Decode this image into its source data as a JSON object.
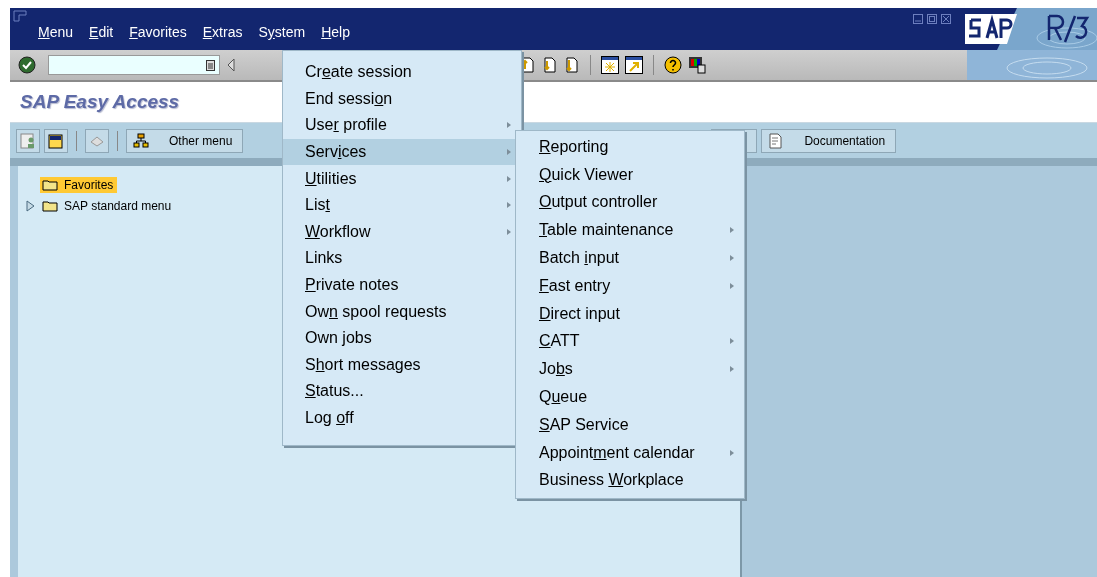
{
  "menu_bar": [
    {
      "label": {
        "key": "M",
        "after": "enu"
      }
    },
    {
      "label": {
        "key": "E",
        "after": "dit"
      }
    },
    {
      "label": {
        "key": "F",
        "after": "avorites"
      }
    },
    {
      "label": {
        "key": "E",
        "after": "xtras"
      }
    },
    {
      "label": {
        "before": "S",
        "key": "y",
        "after": "stem"
      }
    },
    {
      "label": {
        "key": "H",
        "after": "elp"
      }
    }
  ],
  "screen_title": "SAP Easy Access",
  "app_toolbar": {
    "buttons": [
      {
        "label": "Other menu"
      },
      {
        "label": "Documentation"
      }
    ]
  },
  "tree": [
    {
      "label": "Favorites",
      "selected": true,
      "expandable": false
    },
    {
      "label": "SAP standard menu",
      "selected": false,
      "expandable": true
    }
  ],
  "system_menu": [
    {
      "label": {
        "before": "Cr",
        "key": "e",
        "after": "ate session"
      },
      "has_submenu": false,
      "selected": false
    },
    {
      "label": {
        "before": "End sessi",
        "key": "o",
        "after": "n"
      },
      "has_submenu": false,
      "selected": false
    },
    {
      "label": {
        "before": "Use",
        "key": "r",
        "after": " profile"
      },
      "has_submenu": true,
      "selected": false
    },
    {
      "label": {
        "before": "Serv",
        "key": "i",
        "after": "ces"
      },
      "has_submenu": true,
      "selected": true
    },
    {
      "label": {
        "key": "U",
        "after": "tilities"
      },
      "has_submenu": true,
      "selected": false
    },
    {
      "label": {
        "before": "Lis",
        "key": "t"
      },
      "has_submenu": true,
      "selected": false
    },
    {
      "label": {
        "key": "W",
        "after": "orkflow"
      },
      "has_submenu": true,
      "selected": false
    },
    {
      "label": {
        "before": "Links"
      },
      "has_submenu": false,
      "selected": false
    },
    {
      "label": {
        "key": "P",
        "after": "rivate notes"
      },
      "has_submenu": false,
      "selected": false
    },
    {
      "label": {
        "before": "Ow",
        "key": "n",
        "after": " spool requests"
      },
      "has_submenu": false,
      "selected": false
    },
    {
      "label": {
        "before": "Own ",
        "key": "j",
        "after": "obs"
      },
      "has_submenu": false,
      "selected": false
    },
    {
      "label": {
        "before": "S",
        "key": "h",
        "after": "ort messages"
      },
      "has_submenu": false,
      "selected": false
    },
    {
      "label": {
        "key": "S",
        "after": "tatus..."
      },
      "has_submenu": false,
      "selected": false
    },
    {
      "label": {
        "before": "Log ",
        "key": "o",
        "after": "ff"
      },
      "has_submenu": false,
      "selected": false
    }
  ],
  "services_submenu": [
    {
      "label": {
        "key": "R",
        "after": "eporting"
      },
      "has_submenu": false
    },
    {
      "label": {
        "key": "Q",
        "after": "uick Viewer"
      },
      "has_submenu": false
    },
    {
      "label": {
        "key": "O",
        "after": "utput controller"
      },
      "has_submenu": false
    },
    {
      "label": {
        "key": "T",
        "after": "able maintenance"
      },
      "has_submenu": true
    },
    {
      "label": {
        "before": "Batch ",
        "key": "i",
        "after": "nput"
      },
      "has_submenu": true
    },
    {
      "label": {
        "key": "F",
        "after": "ast entry"
      },
      "has_submenu": true
    },
    {
      "label": {
        "key": "D",
        "after": "irect input"
      },
      "has_submenu": false
    },
    {
      "label": {
        "key": "C",
        "after": "ATT"
      },
      "has_submenu": true
    },
    {
      "label": {
        "before": "Jo",
        "key": "b",
        "after": "s"
      },
      "has_submenu": true
    },
    {
      "label": {
        "before": "Q",
        "key": "u",
        "after": "eue"
      },
      "has_submenu": false
    },
    {
      "label": {
        "key": "S",
        "after": "AP Service"
      },
      "has_submenu": false
    },
    {
      "label": {
        "before": "Appoint",
        "key": "m",
        "after": "ent calendar"
      },
      "has_submenu": true
    },
    {
      "label": {
        "before": "Business ",
        "key": "W",
        "after": "orkplace"
      },
      "has_submenu": false
    }
  ]
}
